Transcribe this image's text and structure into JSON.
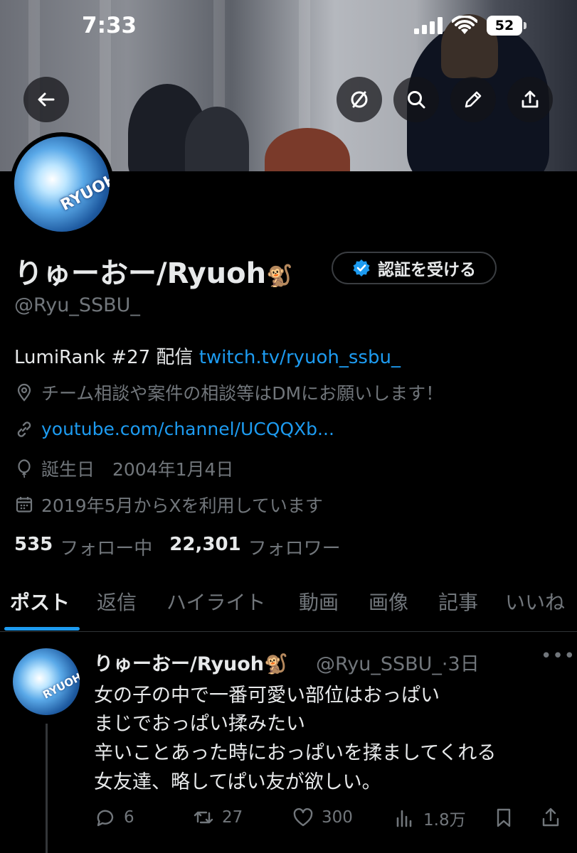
{
  "status_bar": {
    "time": "7:33",
    "battery": "52"
  },
  "profile": {
    "display_name": "りゅーおー/Ryuoh",
    "name_emoji": "🐒",
    "verify_button": "認証を受ける",
    "handle": "@Ryu_SSBU_",
    "bio_text": "LumiRank #27 配信 ",
    "bio_link": "twitch.tv/ryuoh_ssbu_",
    "location": "チーム相談や案件の相談等はDMにお願いします！",
    "website": "youtube.com/channel/UCQQXb...",
    "birthday": "誕生日　2004年1月4日",
    "joined": "2019年5月からXを利用しています",
    "following_count": "535",
    "following_label": "フォロー中",
    "followers_count": "22,301",
    "followers_label": "フォロワー",
    "avatar_text": "RYUOH"
  },
  "tabs": [
    "ポスト",
    "返信",
    "ハイライト",
    "動画",
    "画像",
    "記事",
    "いいね"
  ],
  "post": {
    "author": "りゅーおー/Ryuoh🐒",
    "meta": "@Ryu_SSBU_·3日",
    "more": "•••",
    "lines": [
      "女の子の中で一番可愛い部位はおっぱい",
      "まじでおっぱい揉みたい",
      "辛いことあった時におっぱいを揉ましてくれる",
      "女友達、略してぱい友が欲しい。"
    ],
    "replies": "6",
    "reposts": "27",
    "likes": "300",
    "views": "1.8万"
  },
  "colors": {
    "accent": "#1d9bf0",
    "muted": "#71767b",
    "text": "#e7e9ea",
    "background": "#000000"
  },
  "icons": [
    "back-arrow-icon",
    "circle-slash-icon",
    "search-icon",
    "edit-icon",
    "share-icon",
    "verified-badge-icon",
    "location-icon",
    "link-icon",
    "balloon-icon",
    "calendar-icon",
    "reply-icon",
    "repost-icon",
    "like-icon",
    "views-icon",
    "bookmark-icon"
  ]
}
